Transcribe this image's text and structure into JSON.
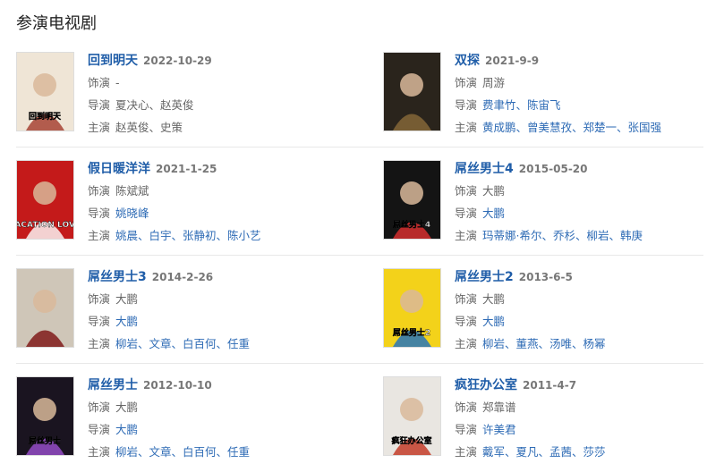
{
  "section_title": "参演电视剧",
  "shows": [
    {
      "title": "回到明天",
      "date": "2022-10-29",
      "role_label": "饰演",
      "role": "-",
      "director_label": "导演",
      "director": "夏决心、赵英俊",
      "cast_label": "主演",
      "cast": "赵英俊、史策",
      "director_link": false,
      "cast_link": false,
      "poster": {
        "bg": "#efe5d6",
        "accent": "#a33a2a",
        "poster_text": "回到明天"
      }
    },
    {
      "title": "双探",
      "date": "2021-9-9",
      "role_label": "饰演",
      "role": "周游",
      "director_label": "导演",
      "director": "费聿竹、陈宙飞",
      "cast_label": "主演",
      "cast": "黄成鹏、曾美慧孜、郑楚一、张国强",
      "director_link": true,
      "cast_link": true,
      "poster": {
        "bg": "#2a241c",
        "accent": "#8a6a3a",
        "poster_text": ""
      }
    },
    {
      "title": "假日暖洋洋",
      "date": "2021-1-25",
      "role_label": "饰演",
      "role": "陈斌斌",
      "director_label": "导演",
      "director": "姚晓峰",
      "cast_label": "主演",
      "cast": "姚晨、白宇、张静初、陈小艺",
      "director_link": true,
      "cast_link": true,
      "poster": {
        "bg": "#c41a1a",
        "accent": "#ffffff",
        "poster_text": "VACATION LOVE"
      }
    },
    {
      "title": "屌丝男士4",
      "date": "2015-05-20",
      "role_label": "饰演",
      "role": "大鹏",
      "director_label": "导演",
      "director": "大鹏",
      "cast_label": "主演",
      "cast": "玛蒂娜·希尔、乔杉、柳岩、韩庚",
      "director_link": true,
      "cast_link": true,
      "poster": {
        "bg": "#141414",
        "accent": "#e03030",
        "poster_text": "屌丝男士4"
      }
    },
    {
      "title": "屌丝男士3",
      "date": "2014-2-26",
      "role_label": "饰演",
      "role": "大鹏",
      "director_label": "导演",
      "director": "大鹏",
      "cast_label": "主演",
      "cast": "柳岩、文章、白百何、任重",
      "director_link": true,
      "cast_link": true,
      "poster": {
        "bg": "#cfc6b8",
        "accent": "#7a1010",
        "poster_text": ""
      }
    },
    {
      "title": "屌丝男士2",
      "date": "2013-6-5",
      "role_label": "饰演",
      "role": "大鹏",
      "director_label": "导演",
      "director": "大鹏",
      "cast_label": "主演",
      "cast": "柳岩、董燕、汤唯、杨幂",
      "director_link": true,
      "cast_link": true,
      "poster": {
        "bg": "#f3d21a",
        "accent": "#1a6fc4",
        "poster_text": "屌丝男士2"
      }
    },
    {
      "title": "屌丝男士",
      "date": "2012-10-10",
      "role_label": "饰演",
      "role": "大鹏",
      "director_label": "导演",
      "director": "大鹏",
      "cast_label": "主演",
      "cast": "柳岩、文章、白百何、任重",
      "director_link": true,
      "cast_link": true,
      "poster": {
        "bg": "#1a1420",
        "accent": "#9b4fd0",
        "poster_text": "屌丝男士"
      }
    },
    {
      "title": "疯狂办公室",
      "date": "2011-4-7",
      "role_label": "饰演",
      "role": "郑靠谱",
      "director_label": "导演",
      "director": "许美君",
      "cast_label": "主演",
      "cast": "戴军、夏凡、孟茜、莎莎",
      "director_link": true,
      "cast_link": true,
      "poster": {
        "bg": "#e9e6e1",
        "accent": "#c0321e",
        "poster_text": "疯狂办公室"
      }
    }
  ]
}
